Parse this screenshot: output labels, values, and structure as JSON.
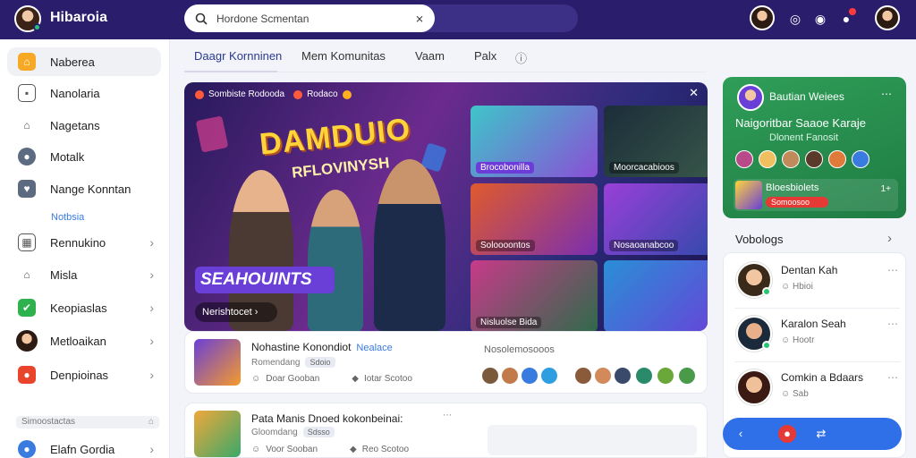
{
  "app": {
    "name": "Hibaroia"
  },
  "search": {
    "placeholder": "Hordone Scmentan"
  },
  "sidebar": {
    "items": [
      {
        "label": "Naberea",
        "icon": "home-icon",
        "active": true,
        "chevron": false
      },
      {
        "label": "Nanolaria",
        "icon": "bookmark-icon",
        "active": false,
        "chevron": false
      },
      {
        "label": "Nagetans",
        "icon": "house-icon",
        "active": false,
        "chevron": false
      },
      {
        "label": "Motalk",
        "icon": "chat-icon",
        "active": false,
        "chevron": false
      },
      {
        "label": "Nange Konntan",
        "icon": "shield-icon",
        "active": false,
        "chevron": false
      },
      {
        "label": "Rennukino",
        "icon": "calendar-icon",
        "active": false,
        "chevron": true
      },
      {
        "label": "Misla",
        "icon": "store-icon",
        "active": false,
        "chevron": true
      },
      {
        "label": "Keopiaslas",
        "icon": "check-icon",
        "active": false,
        "chevron": true
      },
      {
        "label": "Metloaikan",
        "icon": "avatar-icon",
        "active": false,
        "chevron": true
      },
      {
        "label": "Denpioinas",
        "icon": "pin-icon",
        "active": false,
        "chevron": true
      },
      {
        "label": "Elafn Gordia",
        "icon": "globe-icon",
        "active": false,
        "chevron": true
      }
    ],
    "sub_label": "Notbsia",
    "section_label": "Simoostactas"
  },
  "tabs": [
    {
      "label": "Daagr Kornninen",
      "active": true
    },
    {
      "label": "Mem Komunitas",
      "active": false
    },
    {
      "label": "Vaam",
      "active": false
    },
    {
      "label": "Palx",
      "active": false
    }
  ],
  "hero": {
    "tag1": "Sombiste Rodooda",
    "tag2": "Rodaco",
    "title": "DAMDUIO",
    "subtitle": "RFLOVINYSH",
    "banner": "SEAHOUINTS",
    "cta": "Nerishtocet",
    "thumbs": [
      {
        "label": "Brocobonilla"
      },
      {
        "label": "Moorcacabioos"
      },
      {
        "label": "Soloooontos"
      },
      {
        "label": "Nosaoanabcoo"
      },
      {
        "label": "Nisluolse Bida"
      },
      {
        "label": ""
      }
    ]
  },
  "posts": [
    {
      "title": "Nohastine Konondiot",
      "highlight": "Nealace",
      "meta": "Romendang",
      "pill": "Sdoio",
      "stat1": "Doar Gooban",
      "stat2": "Iotar Scotoo",
      "right_title": "Nosolemosooos"
    },
    {
      "title": "Pata Manis Dnoed kokonbeinai:",
      "highlight": "",
      "meta": "Gloomdang",
      "pill": "Sdsso",
      "stat1": "Voor Sooban",
      "stat2": "Reo Scotoo",
      "right_title": ""
    }
  ],
  "group": {
    "name": "Bautian Weiees",
    "title": "Naigoritbar Saaoe Karaje",
    "subtitle": "Dlonent Fanosit",
    "inner_title": "Bloesbiolets",
    "inner_badge": "Somoosoo",
    "inner_count": "1+"
  },
  "vblogs": {
    "title": "Vobologs",
    "items": [
      {
        "name": "Dentan Kah",
        "status": "Hbioi"
      },
      {
        "name": "Karalon Seah",
        "status": "Hootr"
      },
      {
        "name": "Comkin a Bdaars",
        "status": "Sab"
      }
    ]
  },
  "colors": {
    "topbar": "#2a1e6c",
    "accent": "#3a7be0",
    "group_card": "#2f9e58",
    "dock": "#2f6fe8"
  }
}
